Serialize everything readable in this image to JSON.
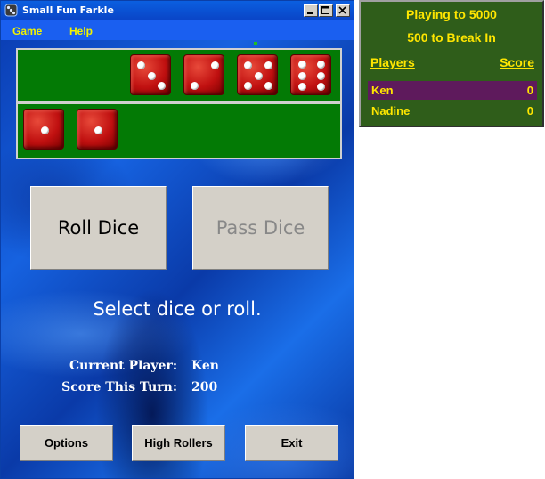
{
  "window": {
    "title": "Small Fun Farkle",
    "icon": "dice-app-icon",
    "controls": [
      "minimize-icon",
      "maximize-icon",
      "close-icon"
    ]
  },
  "menu": {
    "items": [
      {
        "label": "Game"
      },
      {
        "label": "Help"
      }
    ]
  },
  "dice": {
    "held": [
      3,
      2,
      5,
      6
    ],
    "available": [
      1,
      1
    ],
    "color": "#c01010",
    "pip_color": "#ffffff"
  },
  "buttons": {
    "roll": "Roll Dice",
    "pass": "Pass Dice",
    "pass_enabled": false,
    "options": "Options",
    "high_rollers": "High Rollers",
    "exit": "Exit"
  },
  "status": "Select dice or roll.",
  "turn": {
    "current_player_label": "Current Player:",
    "current_player": "Ken",
    "score_label": "Score This Turn:",
    "score": "200"
  },
  "scoreboard": {
    "playing_to": "Playing to 5000",
    "break_in": "500 to Break In",
    "players_header": "Players",
    "score_header": "Score",
    "rows": [
      {
        "name": "Ken",
        "score": "0",
        "active": true
      },
      {
        "name": "Nadine",
        "score": "0",
        "active": false
      }
    ],
    "text_color": "#ffe600",
    "background": "#2f5d1a",
    "active_row_color": "#5e1a5c"
  }
}
